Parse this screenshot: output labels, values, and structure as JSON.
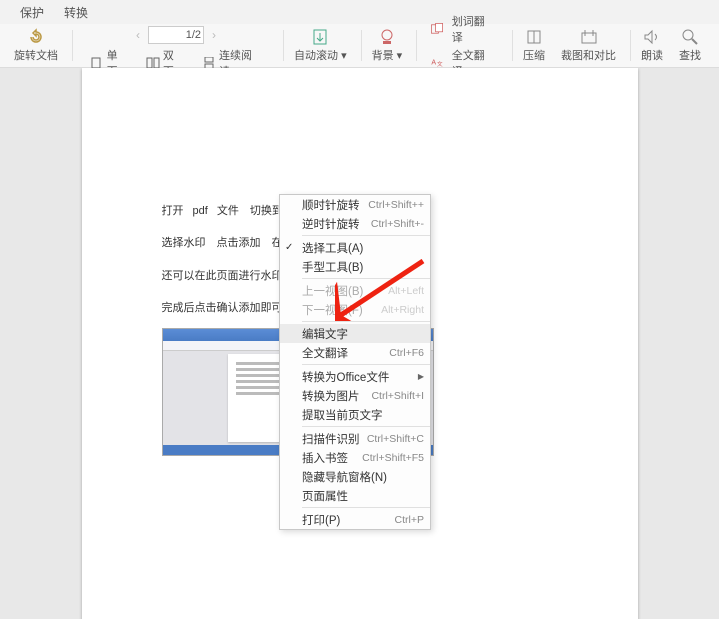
{
  "menubar": {
    "protect": "保护",
    "convert": "转换"
  },
  "toolbar": {
    "rotate": {
      "label": "旋转文档"
    },
    "nav": {
      "prev": "‹",
      "next": "›",
      "page_field": "1/2"
    },
    "single_page": "单页",
    "double_page": "双页",
    "continuous": "连续阅读",
    "auto_scroll": "自动滚动",
    "background": "背景",
    "highlight_translate": "划词翻译",
    "full_translate": "全文翻译",
    "compress": "压缩",
    "crop_compare": "裁图和对比",
    "read_aloud": "朗读",
    "find": "查找"
  },
  "document": {
    "line1": "打开 pdf 文件　切换到插入",
    "line2": "选择水印　点击添加　在",
    "line3": "还可以在此页面进行水印的",
    "line4": "完成后点击确认添加即可"
  },
  "context_menu": {
    "items": [
      {
        "label": "顺时针旋转",
        "shortcut": "Ctrl+Shift++",
        "type": "item"
      },
      {
        "label": "逆时针旋转",
        "shortcut": "Ctrl+Shift+-",
        "type": "item"
      },
      {
        "type": "sep"
      },
      {
        "label": "选择工具(A)",
        "shortcut": "",
        "type": "item",
        "checked": true
      },
      {
        "label": "手型工具(B)",
        "shortcut": "",
        "type": "item"
      },
      {
        "type": "sep"
      },
      {
        "label": "上一视图(B)",
        "shortcut": "Alt+Left",
        "type": "item",
        "disabled": true
      },
      {
        "label": "下一视图(F)",
        "shortcut": "Alt+Right",
        "type": "item",
        "disabled": true
      },
      {
        "type": "sep"
      },
      {
        "label": "编辑文字",
        "shortcut": "",
        "type": "item",
        "highlighted": true
      },
      {
        "label": "全文翻译",
        "shortcut": "Ctrl+F6",
        "type": "item"
      },
      {
        "type": "sep"
      },
      {
        "label": "转换为Office文件",
        "shortcut": "",
        "type": "submenu"
      },
      {
        "label": "转换为图片",
        "shortcut": "Ctrl+Shift+I",
        "type": "item"
      },
      {
        "label": "提取当前页文字",
        "shortcut": "",
        "type": "item"
      },
      {
        "type": "sep"
      },
      {
        "label": "扫描件识别",
        "shortcut": "Ctrl+Shift+C",
        "type": "item"
      },
      {
        "label": "插入书签",
        "shortcut": "Ctrl+Shift+F5",
        "type": "item"
      },
      {
        "label": "隐藏导航窗格(N)",
        "shortcut": "",
        "type": "item"
      },
      {
        "label": "页面属性",
        "shortcut": "",
        "type": "item"
      },
      {
        "type": "sep"
      },
      {
        "label": "打印(P)",
        "shortcut": "Ctrl+P",
        "type": "item"
      }
    ]
  }
}
